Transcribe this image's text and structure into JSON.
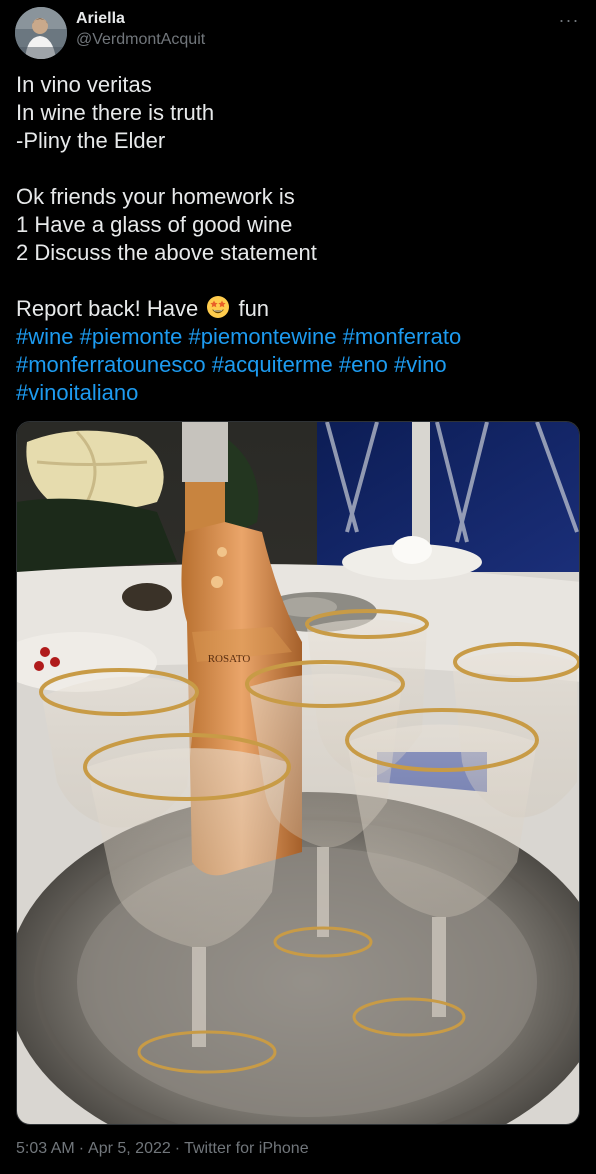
{
  "user": {
    "display_name": "Ariella",
    "handle": "@VerdmontAcquit"
  },
  "more_label": "···",
  "tweet": {
    "line1": "In vino veritas",
    "line2": "In wine there is truth",
    "line3": "-Pliny the Elder",
    "line4": "Ok friends your homework is",
    "line5": "1 Have a glass of good wine",
    "line6": "2 Discuss the above statement",
    "line7_before": "Report back! Have",
    "line7_after": "fun",
    "emoji_icon": "star-struck-emoji",
    "hashtags_line1": [
      "#wine",
      "#piemonte",
      "#piemontewine",
      "#monferrato"
    ],
    "hashtags_line2": [
      "#monferratounesco",
      "#acquiterme",
      "#eno",
      "#vino"
    ],
    "hashtags_line3": [
      "#vinoitaliano"
    ]
  },
  "media": {
    "bottle_label": "ROSATO"
  },
  "meta": {
    "time": "5:03 AM",
    "date": "Apr 5, 2022",
    "source": "Twitter for iPhone"
  },
  "colors": {
    "background": "#000000",
    "text": "#e7e9ea",
    "secondary": "#71767b",
    "link": "#1d9bf0"
  }
}
